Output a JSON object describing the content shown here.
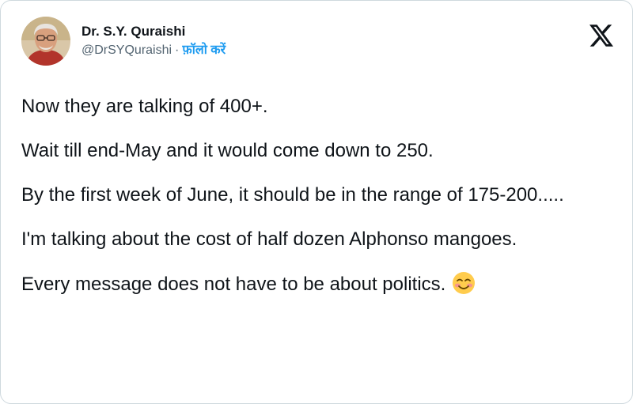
{
  "author": {
    "display_name": "Dr. S.Y. Quraishi",
    "handle": "@DrSYQuraishi",
    "separator": "·",
    "follow_label": "फ़ॉलो करें",
    "avatar_icon": "profile-photo",
    "platform_icon": "x-logo-icon"
  },
  "tweet": {
    "paragraphs": [
      "Now they are talking of 400+.",
      "Wait till end-May and it would come down to 250.",
      "By the first week of June, it should be in the range of 175-200.....",
      "I'm talking about the cost of half dozen Alphonso mangoes.",
      "Every message does not have to be about politics."
    ],
    "trailing_emoji": "smiling-face-with-blush-icon"
  },
  "colors": {
    "text": "#0f1419",
    "secondary": "#536471",
    "link": "#1d9bf0",
    "border": "#cfd9de"
  }
}
